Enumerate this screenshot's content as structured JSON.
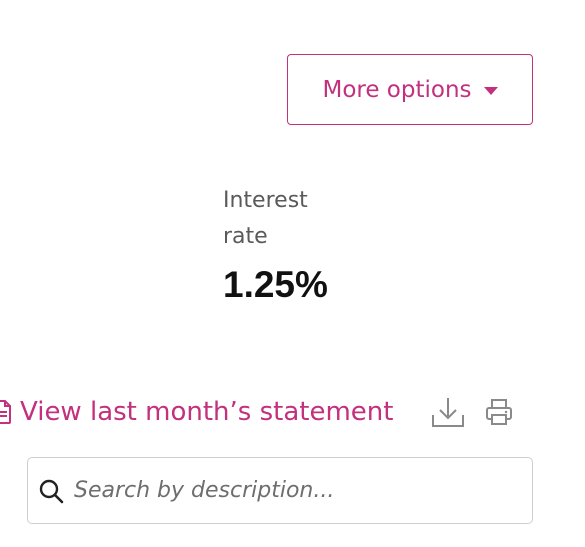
{
  "actions": {
    "more_options_label": "More options"
  },
  "summary": {
    "rate_label": "Interest rate",
    "rate_value": "1.25%"
  },
  "statement": {
    "link_label": "View last month’s statement",
    "download_icon": "download-icon",
    "print_icon": "print-icon"
  },
  "search": {
    "placeholder": "Search by description...",
    "value": ""
  },
  "colors": {
    "accent": "#c2307e",
    "muted_text": "#5a5a5a",
    "icon_gray": "#8a8a8a",
    "border": "#cfcfcf"
  }
}
